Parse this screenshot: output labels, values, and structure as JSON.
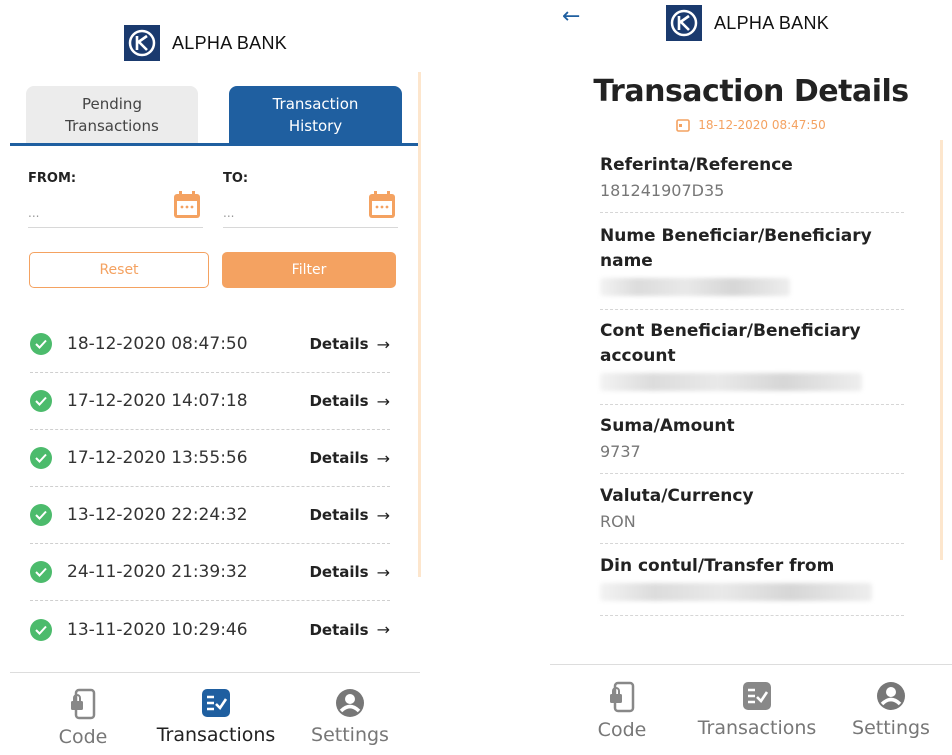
{
  "brand": {
    "name": "ALPHA BANK",
    "color": "#1a3a6e",
    "accent": "#f4a261",
    "tab_blue": "#1f5fa0"
  },
  "history_screen": {
    "tabs": [
      {
        "label": "Pending\nTransactions",
        "active": false
      },
      {
        "label": "Transaction\nHistory",
        "active": true
      }
    ],
    "filter": {
      "from_label": "FROM:",
      "to_label": "TO:",
      "from_placeholder": "...",
      "to_placeholder": "...",
      "reset_label": "Reset",
      "filter_label": "Filter"
    },
    "transactions": [
      {
        "date": "18-12-2020 08:47:50",
        "action": "Details"
      },
      {
        "date": "17-12-2020 14:07:18",
        "action": "Details"
      },
      {
        "date": "17-12-2020 13:55:56",
        "action": "Details"
      },
      {
        "date": "13-12-2020 22:24:32",
        "action": "Details"
      },
      {
        "date": "24-11-2020 21:39:32",
        "action": "Details"
      },
      {
        "date": "13-11-2020 10:29:46",
        "action": "Details"
      }
    ],
    "nav": {
      "code": "Code",
      "transactions": "Transactions",
      "settings": "Settings",
      "active": "transactions"
    }
  },
  "detail_screen": {
    "title": "Transaction Details",
    "date": "18-12-2020 08:47:50",
    "fields": [
      {
        "label": "Referinta/Reference",
        "value": "181241907D35"
      },
      {
        "label": "Nume Beneficiar/Beneficiary name",
        "value": ""
      },
      {
        "label": "Cont Beneficiar/Beneficiary account",
        "value": ""
      },
      {
        "label": "Suma/Amount",
        "value": "9737"
      },
      {
        "label": "Valuta/Currency",
        "value": "RON"
      },
      {
        "label": "Din contul/Transfer from",
        "value": ""
      }
    ],
    "nav": {
      "code": "Code",
      "transactions": "Transactions",
      "settings": "Settings",
      "active": "none"
    }
  }
}
